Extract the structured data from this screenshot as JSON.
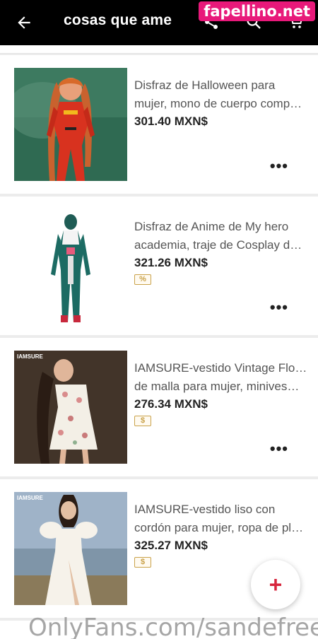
{
  "header": {
    "title": "cosas que ame",
    "icons": [
      "back-arrow-icon",
      "share-icon",
      "search-icon",
      "cart-icon"
    ]
  },
  "watermarks": {
    "top": "fapellino.net",
    "bottom": "OnlyFans.com/sandefree"
  },
  "products": [
    {
      "title_line1": "Disfraz de Halloween para",
      "title_line2": "mujer, mono de cuerpo comp…",
      "price": "301.40 MXN$",
      "badge": "",
      "more": "•••"
    },
    {
      "title_line1": "Disfraz de Anime de My hero",
      "title_line2": "academia, traje de Cosplay de…",
      "price": "321.26 MXN$",
      "badge": "%",
      "more": "•••"
    },
    {
      "title_line1": "IAMSURE-vestido Vintage Floral",
      "title_line2": "de malla para mujer, minives…",
      "price": "276.34 MXN$",
      "badge": "$",
      "thumb_label": "IAMSURE",
      "more": "•••"
    },
    {
      "title_line1": "IAMSURE-vestido liso con",
      "title_line2": "cordón para mujer, ropa de pl…",
      "price": "325.27 MXN$",
      "badge": "$",
      "thumb_label": "IAMSURE",
      "more": "•••"
    }
  ],
  "fab": {
    "label": "+"
  },
  "colors": {
    "accent": "#d7263d",
    "badge": "#c9a24a",
    "watermark_pink": "#e8197a"
  }
}
